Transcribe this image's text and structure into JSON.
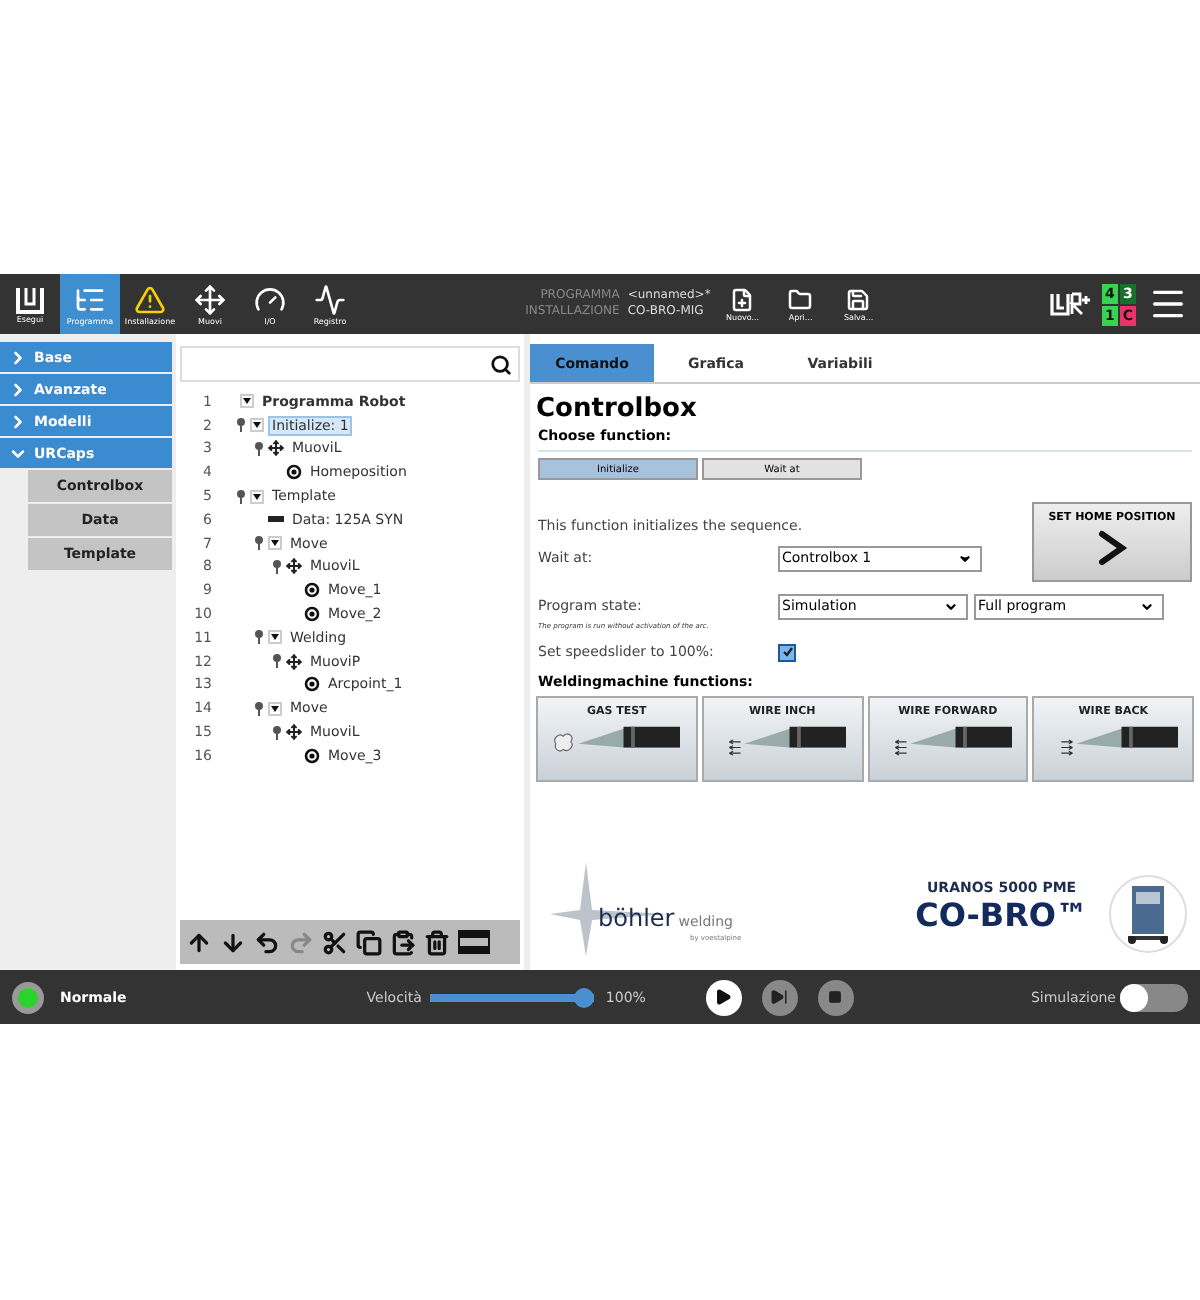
{
  "top_bar": {
    "nav_items": [
      {
        "kind": "run",
        "label": "Esegui",
        "selected": false
      },
      {
        "kind": "program",
        "label": "Programma",
        "selected": true
      },
      {
        "kind": "installation",
        "label": "Installazione",
        "selected": false
      },
      {
        "kind": "move",
        "label": "Muovi",
        "selected": false
      },
      {
        "kind": "io",
        "label": "I/O",
        "selected": false
      },
      {
        "kind": "log",
        "label": "Registro",
        "selected": false
      }
    ],
    "program_label": "PROGRAMMA",
    "program_name": "<unnamed>*",
    "installation_label": "INSTALLAZIONE",
    "installation_name": "CO-BRO-MIG",
    "file_buttons": [
      {
        "kind": "new",
        "label": "Nuovo..."
      },
      {
        "kind": "open",
        "label": "Apri..."
      },
      {
        "kind": "save",
        "label": "Salva..."
      }
    ],
    "status_counts": [
      {
        "text": "4",
        "color": "#39d353"
      },
      {
        "text": "3",
        "color": "#17702b"
      },
      {
        "text": "1",
        "color": "#39d353"
      },
      {
        "text": "C",
        "color": "#e8336b"
      }
    ]
  },
  "sidebar": {
    "items": [
      {
        "label": "Base",
        "expanded": false
      },
      {
        "label": "Avanzate",
        "expanded": false
      },
      {
        "label": "Modelli",
        "expanded": false
      },
      {
        "label": "URCaps",
        "expanded": true,
        "children": [
          {
            "label": "Controlbox"
          },
          {
            "label": "Data"
          },
          {
            "label": "Template"
          }
        ]
      }
    ]
  },
  "tree": {
    "nodes": [
      {
        "number": "1",
        "label": "Programma Robot",
        "kind": "root",
        "selected": false,
        "expanded": true,
        "children": [
          {
            "number": "2",
            "label": "Initialize: 1",
            "kind": "folder",
            "selected": true,
            "expanded": true,
            "children": [
              {
                "number": "3",
                "label": "MuoviL",
                "kind": "move",
                "selected": false,
                "children": [
                  {
                    "number": "4",
                    "label": "Homeposition",
                    "kind": "waypoint",
                    "selected": false
                  }
                ]
              }
            ]
          },
          {
            "number": "5",
            "label": "Template",
            "kind": "folder",
            "selected": false,
            "expanded": true,
            "children": [
              {
                "number": "6",
                "label": "Data: 125A SYN",
                "kind": "data",
                "selected": false
              },
              {
                "number": "7",
                "label": "Move",
                "kind": "folder",
                "selected": false,
                "expanded": true,
                "children": [
                  {
                    "number": "8",
                    "label": "MuoviL",
                    "kind": "move",
                    "selected": false,
                    "children": [
                      {
                        "number": "9",
                        "label": "Move_1",
                        "kind": "waypoint",
                        "selected": false
                      },
                      {
                        "number": "10",
                        "label": "Move_2",
                        "kind": "waypoint",
                        "selected": false
                      }
                    ]
                  }
                ]
              },
              {
                "number": "11",
                "label": "Welding",
                "kind": "folder",
                "selected": false,
                "expanded": true,
                "children": [
                  {
                    "number": "12",
                    "label": "MuoviP",
                    "kind": "move",
                    "selected": false,
                    "children": [
                      {
                        "number": "13",
                        "label": "Arcpoint_1",
                        "kind": "waypoint",
                        "selected": false
                      }
                    ]
                  }
                ]
              },
              {
                "number": "14",
                "label": "Move",
                "kind": "folder",
                "selected": false,
                "expanded": true,
                "children": [
                  {
                    "number": "15",
                    "label": "MuoviL",
                    "kind": "move",
                    "selected": false,
                    "children": [
                      {
                        "number": "16",
                        "label": "Move_3",
                        "kind": "waypoint",
                        "selected": false
                      }
                    ]
                  }
                ]
              }
            ]
          }
        ]
      }
    ],
    "tools": [
      {
        "kind": "up",
        "disabled": false
      },
      {
        "kind": "down",
        "disabled": false
      },
      {
        "kind": "undo",
        "disabled": false
      },
      {
        "kind": "redo",
        "disabled": true
      },
      {
        "kind": "cut",
        "disabled": false
      },
      {
        "kind": "copy",
        "disabled": false
      },
      {
        "kind": "paste",
        "disabled": false
      },
      {
        "kind": "delete",
        "disabled": false
      },
      {
        "kind": "suppress",
        "disabled": false
      }
    ]
  },
  "panel": {
    "tabs": [
      {
        "label": "Comando",
        "selected": true
      },
      {
        "label": "Grafica",
        "selected": false
      },
      {
        "label": "Variabili",
        "selected": false
      }
    ],
    "title": "Controlbox",
    "choose_label": "Choose function:",
    "function_buttons": [
      {
        "label": "Initialize",
        "selected": true
      },
      {
        "label": "Wait at",
        "selected": false
      }
    ],
    "description": "This function initializes the sequence.",
    "home_button": "SET HOME POSITION",
    "wait_at": {
      "label": "Wait at:",
      "value": "Controlbox 1"
    },
    "program_state": {
      "label": "Program state:",
      "values": [
        "Simulation",
        "Full program"
      ]
    },
    "note": "The program is run without activation of the arc.",
    "speedslider": {
      "label": "Set speedslider to 100%:",
      "checked": true
    },
    "welding_heading": "Weldingmachine functions:",
    "welding_buttons": [
      {
        "label": "GAS TEST",
        "kind": "gas"
      },
      {
        "label": "WIRE INCH",
        "kind": "inch"
      },
      {
        "label": "WIRE FORWARD",
        "kind": "forward"
      },
      {
        "label": "WIRE BACK",
        "kind": "back"
      }
    ],
    "brand": {
      "name": "böhler",
      "suffix": "welding",
      "tagline": "by voestalpine"
    },
    "product": {
      "model": "URANOS 5000 PME",
      "name": "CO-BRO™"
    }
  },
  "bottom_bar": {
    "status": {
      "label": "Normale",
      "color": "#2bd42b"
    },
    "speed": {
      "label": "Velocità",
      "level": 1.0,
      "reading": "100%"
    },
    "simulation": {
      "label": "Simulazione",
      "on": false
    }
  }
}
